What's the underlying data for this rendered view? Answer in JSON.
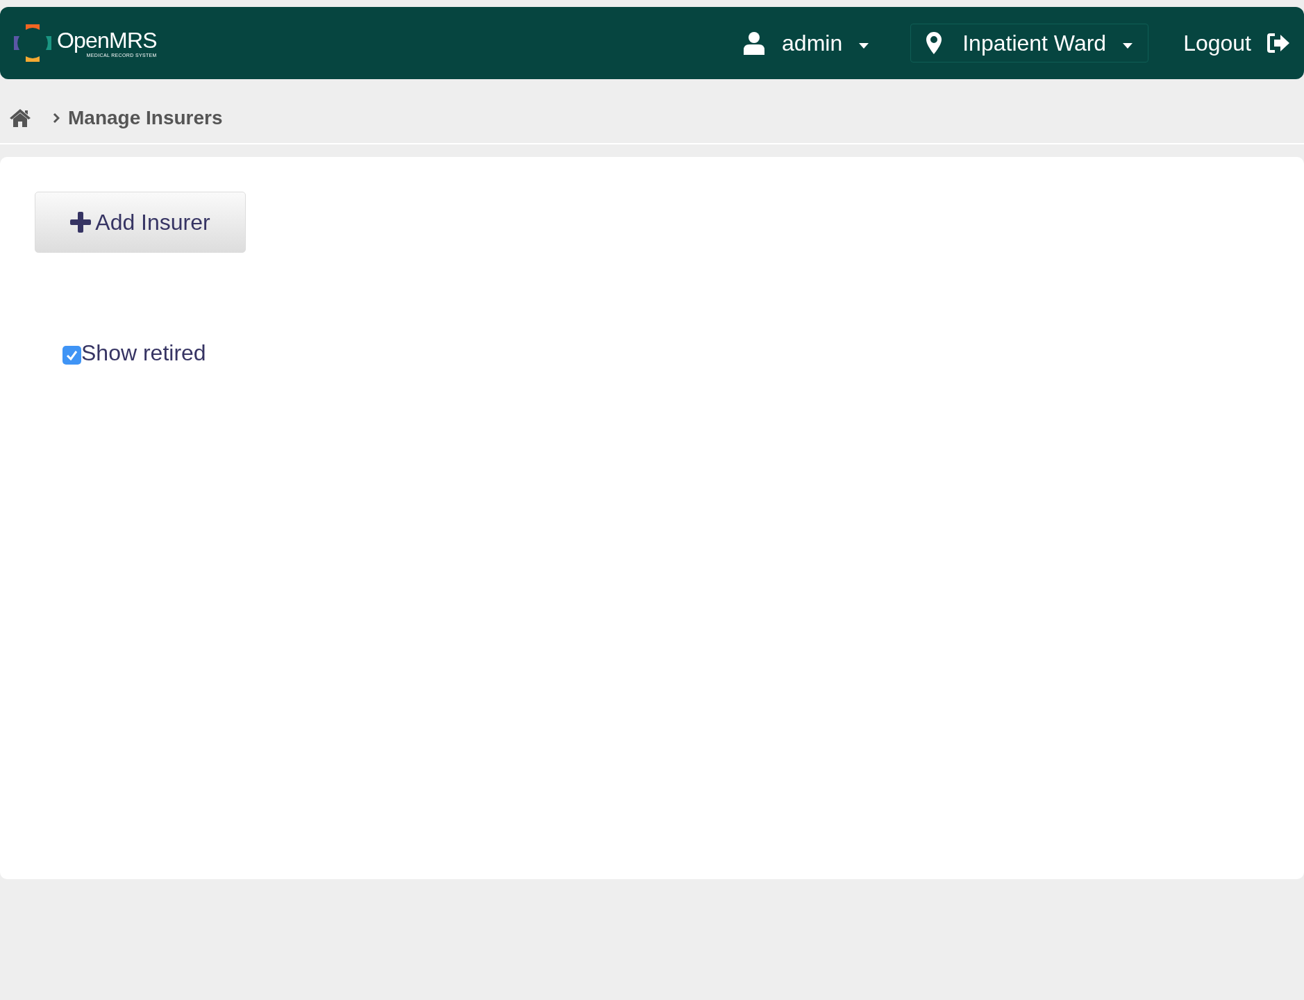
{
  "header": {
    "logo": {
      "name": "OpenMRS",
      "tagline": "MEDICAL RECORD SYSTEM"
    },
    "user": {
      "label": "admin"
    },
    "location": {
      "label": "Inpatient Ward"
    },
    "logout": {
      "label": "Logout"
    }
  },
  "breadcrumb": {
    "current": "Manage Insurers"
  },
  "actions": {
    "add_button": "Add Insurer"
  },
  "filter": {
    "label": "Show retired",
    "checked": true
  }
}
